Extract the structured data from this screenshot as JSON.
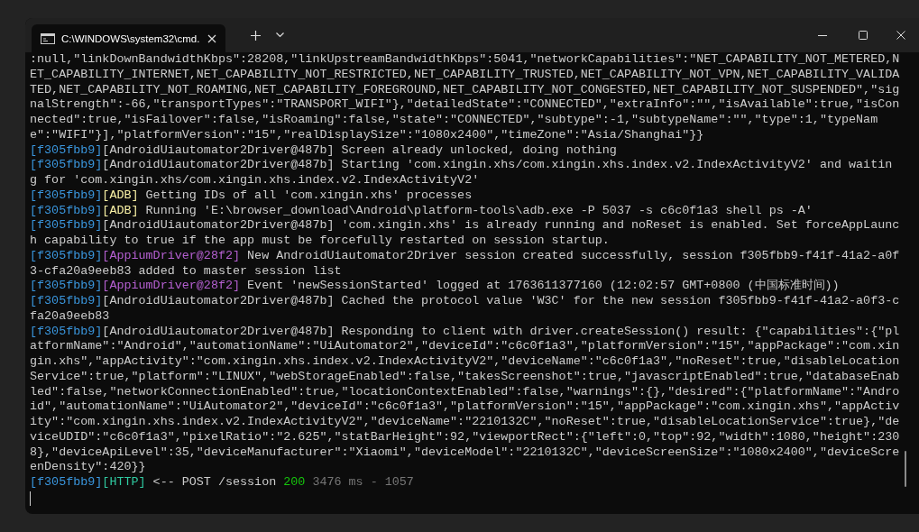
{
  "window": {
    "title": "C:\\WINDOWS\\system32\\cmd."
  },
  "log": [
    {
      "segments": [
        {
          "kind": "plain",
          "text": ":null,\"linkDownBandwidthKbps\":28208,\"linkUpstreamBandwidthKbps\":5041,\"networkCapabilities\":\"NET_CAPABILITY_NOT_METERED,NET_CAPABILITY_INTERNET,NET_CAPABILITY_NOT_RESTRICTED,NET_CAPABILITY_TRUSTED,NET_CAPABILITY_NOT_VPN,NET_CAPABILITY_VALIDATED,NET_CAPABILITY_NOT_ROAMING,NET_CAPABILITY_FOREGROUND,NET_CAPABILITY_NOT_CONGESTED,NET_CAPABILITY_NOT_SUSPENDED\",\"signalStrength\":-66,\"transportTypes\":\"TRANSPORT_WIFI\"},\"detailedState\":\"CONNECTED\",\"extraInfo\":\"\",\"isAvailable\":true,\"isConnected\":true,\"isFailover\":false,\"isRoaming\":false,\"state\":\"CONNECTED\",\"subtype\":-1,\"subtypeName\":\"\",\"type\":1,\"typeName\":\"WIFI\"}],\"platformVersion\":\"15\",\"realDisplaySize\":\"1080x2400\",\"timeZone\":\"Asia/Shanghai\"}}"
        }
      ]
    },
    {
      "segments": [
        {
          "kind": "session",
          "text": "[f305fbb9]"
        },
        {
          "kind": "driver",
          "text": "[AndroidUiautomator2Driver@487b]"
        },
        {
          "kind": "plain",
          "text": " Screen already unlocked, doing nothing"
        }
      ]
    },
    {
      "segments": [
        {
          "kind": "session",
          "text": "[f305fbb9]"
        },
        {
          "kind": "driver",
          "text": "[AndroidUiautomator2Driver@487b]"
        },
        {
          "kind": "plain",
          "text": " Starting 'com.xingin.xhs/com.xingin.xhs.index.v2.IndexActivityV2' and waiting for 'com.xingin.xhs/com.xingin.xhs.index.v2.IndexActivityV2'"
        }
      ]
    },
    {
      "segments": [
        {
          "kind": "session",
          "text": "[f305fbb9]"
        },
        {
          "kind": "adb",
          "text": "[ADB]"
        },
        {
          "kind": "plain",
          "text": " Getting IDs of all 'com.xingin.xhs' processes"
        }
      ]
    },
    {
      "segments": [
        {
          "kind": "session",
          "text": "[f305fbb9]"
        },
        {
          "kind": "adb",
          "text": "[ADB]"
        },
        {
          "kind": "plain",
          "text": " Running 'E:\\browser_download\\Android\\platform-tools\\adb.exe -P 5037 -s c6c0f1a3 shell ps -A'"
        }
      ]
    },
    {
      "segments": [
        {
          "kind": "session",
          "text": "[f305fbb9]"
        },
        {
          "kind": "driver",
          "text": "[AndroidUiautomator2Driver@487b]"
        },
        {
          "kind": "plain",
          "text": " 'com.xingin.xhs' is already running and noReset is enabled. Set forceAppLaunch capability to true if the app must be forcefully restarted on session startup."
        }
      ]
    },
    {
      "segments": [
        {
          "kind": "session",
          "text": "[f305fbb9]"
        },
        {
          "kind": "appium",
          "text": "[AppiumDriver@28f2]"
        },
        {
          "kind": "plain",
          "text": " New AndroidUiautomator2Driver session created successfully, session f305fbb9-f41f-41a2-a0f3-cfa20a9eeb83 added to master session list"
        }
      ]
    },
    {
      "segments": [
        {
          "kind": "session",
          "text": "[f305fbb9]"
        },
        {
          "kind": "appium",
          "text": "[AppiumDriver@28f2]"
        },
        {
          "kind": "plain",
          "text": " Event 'newSessionStarted' logged at 1763611377160 (12:02:57 GMT+0800 (中国标准时间))"
        }
      ]
    },
    {
      "segments": [
        {
          "kind": "session",
          "text": "[f305fbb9]"
        },
        {
          "kind": "driver",
          "text": "[AndroidUiautomator2Driver@487b]"
        },
        {
          "kind": "plain",
          "text": " Cached the protocol value 'W3C' for the new session f305fbb9-f41f-41a2-a0f3-cfa20a9eeb83"
        }
      ]
    },
    {
      "segments": [
        {
          "kind": "session",
          "text": "[f305fbb9]"
        },
        {
          "kind": "driver",
          "text": "[AndroidUiautomator2Driver@487b]"
        },
        {
          "kind": "plain",
          "text": " Responding to client with driver.createSession() result: {\"capabilities\":{\"platformName\":\"Android\",\"automationName\":\"UiAutomator2\",\"deviceId\":\"c6c0f1a3\",\"platformVersion\":\"15\",\"appPackage\":\"com.xingin.xhs\",\"appActivity\":\"com.xingin.xhs.index.v2.IndexActivityV2\",\"deviceName\":\"c6c0f1a3\",\"noReset\":true,\"disableLocationService\":true,\"platform\":\"LINUX\",\"webStorageEnabled\":false,\"takesScreenshot\":true,\"javascriptEnabled\":true,\"databaseEnabled\":false,\"networkConnectionEnabled\":true,\"locationContextEnabled\":false,\"warnings\":{},\"desired\":{\"platformName\":\"Android\",\"automationName\":\"UiAutomator2\",\"deviceId\":\"c6c0f1a3\",\"platformVersion\":\"15\",\"appPackage\":\"com.xingin.xhs\",\"appActivity\":\"com.xingin.xhs.index.v2.IndexActivityV2\",\"deviceName\":\"2210132C\",\"noReset\":true,\"disableLocationService\":true},\"deviceUDID\":\"c6c0f1a3\",\"pixelRatio\":\"2.625\",\"statBarHeight\":92,\"viewportRect\":{\"left\":0,\"top\":92,\"width\":1080,\"height\":2308},\"deviceApiLevel\":35,\"deviceManufacturer\":\"Xiaomi\",\"deviceModel\":\"2210132C\",\"deviceScreenSize\":\"1080x2400\",\"deviceScreenDensity\":420}}"
        }
      ]
    },
    {
      "segments": [
        {
          "kind": "session",
          "text": "[f305fbb9]"
        },
        {
          "kind": "http",
          "text": "[HTTP]"
        },
        {
          "kind": "plain",
          "text": " <-- POST /session "
        },
        {
          "kind": "status",
          "text": "200"
        },
        {
          "kind": "timing",
          "text": " 3476 ms - 1057"
        }
      ]
    }
  ]
}
